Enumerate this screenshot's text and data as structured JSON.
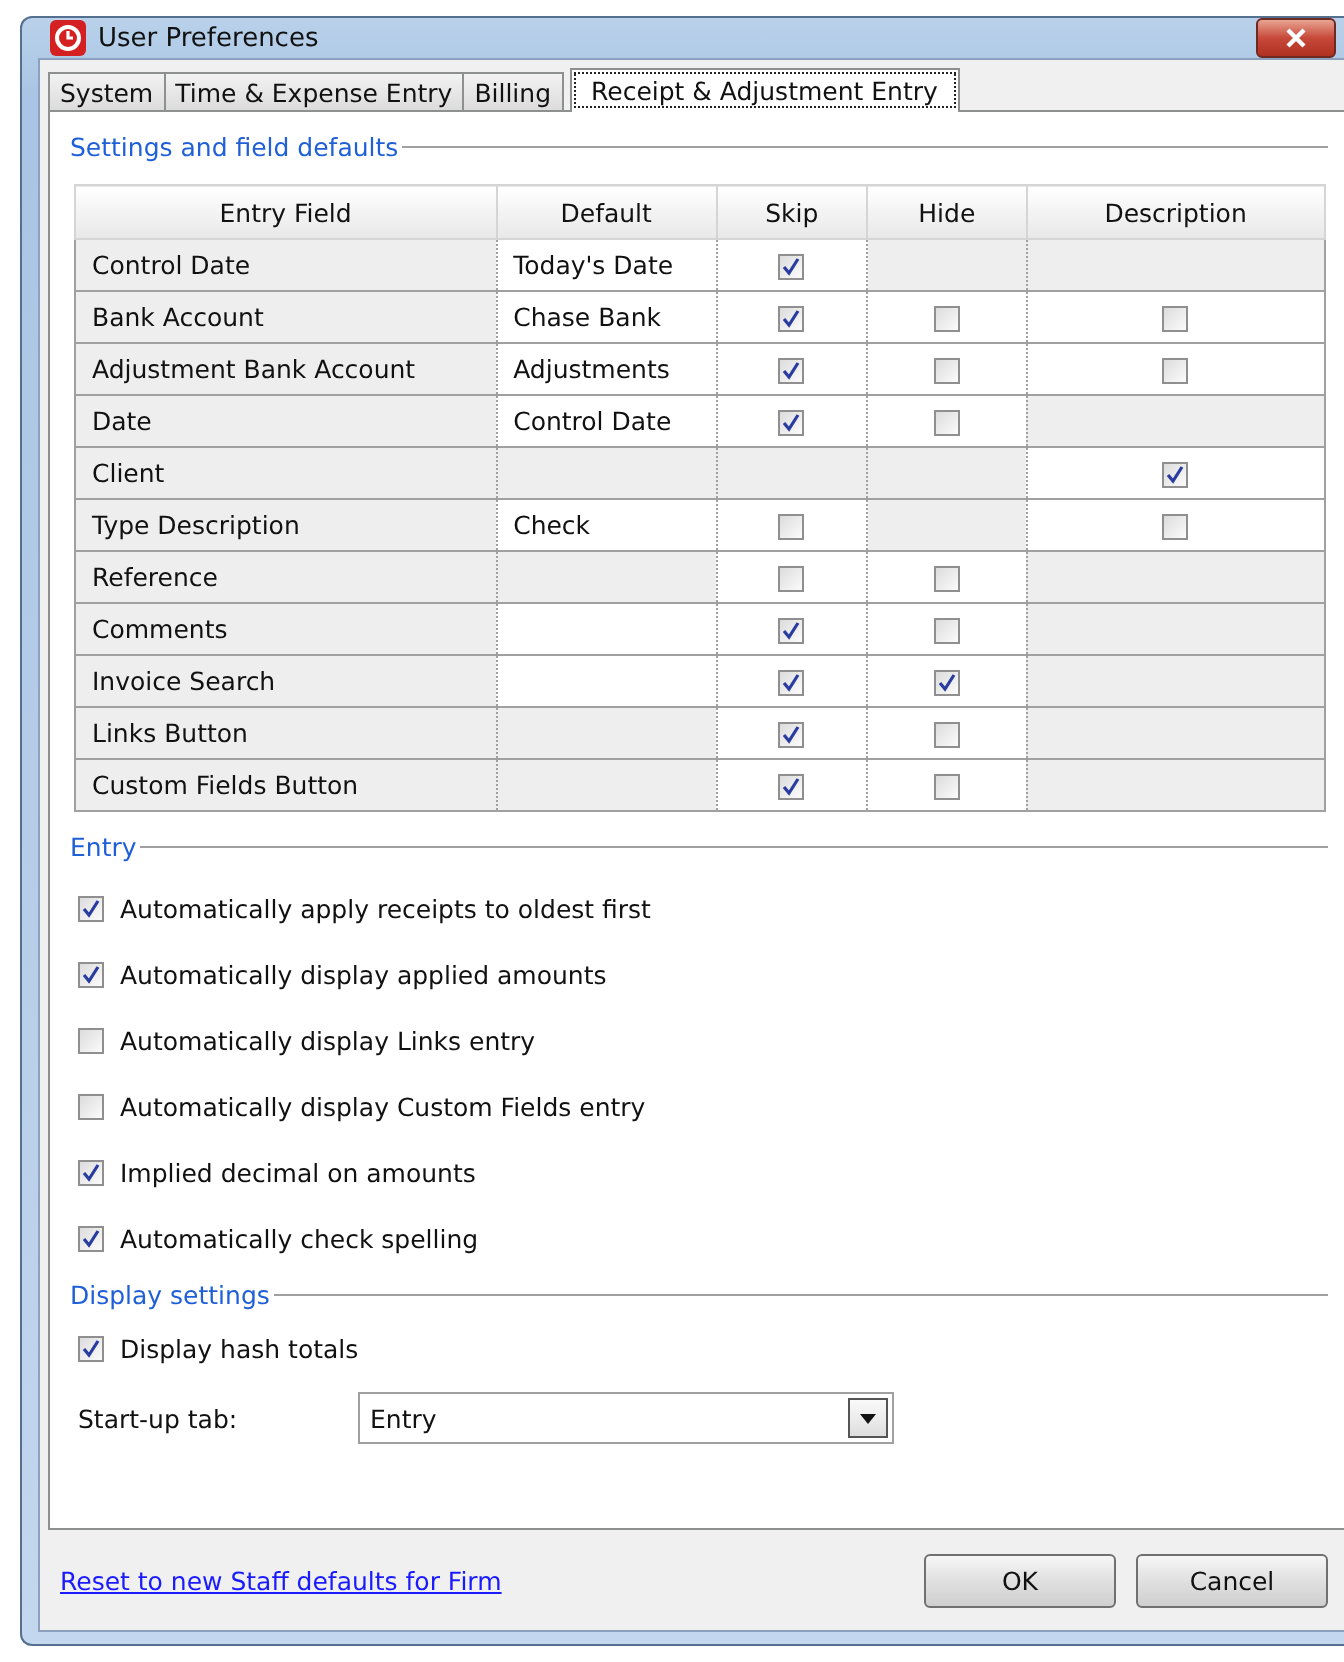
{
  "window": {
    "title": "User Preferences"
  },
  "tabs": [
    {
      "label": "System",
      "selected": false
    },
    {
      "label": "Time & Expense Entry",
      "selected": false
    },
    {
      "label": "Billing",
      "selected": false
    },
    {
      "label": "Receipt & Adjustment Entry",
      "selected": true
    }
  ],
  "settings_section": {
    "title": "Settings and field defaults",
    "columns": [
      "Entry Field",
      "Default",
      "Skip",
      "Hide",
      "Description"
    ],
    "rows": [
      {
        "field": "Control Date",
        "default": {
          "kind": "text",
          "value": "Today's Date"
        },
        "skip": {
          "kind": "checkbox",
          "checked": true
        },
        "hide": {
          "kind": "blank"
        },
        "description": {
          "kind": "blank"
        }
      },
      {
        "field": "Bank Account",
        "default": {
          "kind": "text",
          "value": "Chase Bank"
        },
        "skip": {
          "kind": "checkbox",
          "checked": true
        },
        "hide": {
          "kind": "checkbox",
          "checked": false
        },
        "description": {
          "kind": "checkbox",
          "checked": false
        }
      },
      {
        "field": "Adjustment Bank Account",
        "default": {
          "kind": "text",
          "value": "Adjustments"
        },
        "skip": {
          "kind": "checkbox",
          "checked": true
        },
        "hide": {
          "kind": "checkbox",
          "checked": false
        },
        "description": {
          "kind": "checkbox",
          "checked": false
        }
      },
      {
        "field": "Date",
        "default": {
          "kind": "text",
          "value": "Control Date"
        },
        "skip": {
          "kind": "checkbox",
          "checked": true
        },
        "hide": {
          "kind": "checkbox",
          "checked": false
        },
        "description": {
          "kind": "blank"
        }
      },
      {
        "field": "Client",
        "default": {
          "kind": "blank"
        },
        "skip": {
          "kind": "blank"
        },
        "hide": {
          "kind": "blank"
        },
        "description": {
          "kind": "checkbox",
          "checked": true
        }
      },
      {
        "field": "Type Description",
        "default": {
          "kind": "text",
          "value": "Check"
        },
        "skip": {
          "kind": "checkbox",
          "checked": false
        },
        "hide": {
          "kind": "blank"
        },
        "description": {
          "kind": "checkbox",
          "checked": false
        }
      },
      {
        "field": "Reference",
        "default": {
          "kind": "blank"
        },
        "skip": {
          "kind": "checkbox",
          "checked": false
        },
        "hide": {
          "kind": "checkbox",
          "checked": false
        },
        "description": {
          "kind": "blank"
        }
      },
      {
        "field": "Comments",
        "default": {
          "kind": "empty"
        },
        "skip": {
          "kind": "checkbox",
          "checked": true
        },
        "hide": {
          "kind": "checkbox",
          "checked": false
        },
        "description": {
          "kind": "blank"
        }
      },
      {
        "field": "Invoice Search",
        "default": {
          "kind": "empty"
        },
        "skip": {
          "kind": "checkbox",
          "checked": true
        },
        "hide": {
          "kind": "checkbox",
          "checked": true
        },
        "description": {
          "kind": "blank"
        }
      },
      {
        "field": "Links Button",
        "default": {
          "kind": "blank"
        },
        "skip": {
          "kind": "checkbox",
          "checked": true
        },
        "hide": {
          "kind": "checkbox",
          "checked": false
        },
        "description": {
          "kind": "blank"
        }
      },
      {
        "field": "Custom Fields Button",
        "default": {
          "kind": "blank"
        },
        "skip": {
          "kind": "checkbox",
          "checked": true
        },
        "hide": {
          "kind": "checkbox",
          "checked": false
        },
        "description": {
          "kind": "blank"
        }
      }
    ]
  },
  "entry_section": {
    "title": "Entry",
    "options": [
      {
        "label": "Automatically apply receipts to oldest first",
        "checked": true
      },
      {
        "label": "Automatically display applied amounts",
        "checked": true
      },
      {
        "label": "Automatically display Links entry",
        "checked": false
      },
      {
        "label": "Automatically display Custom Fields entry",
        "checked": false
      },
      {
        "label": "Implied decimal on amounts",
        "checked": true
      },
      {
        "label": "Automatically check spelling",
        "checked": true
      }
    ]
  },
  "display_section": {
    "title": "Display settings",
    "options": [
      {
        "label": "Display hash totals",
        "checked": true
      }
    ],
    "startup_tab": {
      "label": "Start-up tab:",
      "value": "Entry"
    }
  },
  "footer": {
    "link": "Reset to new Staff defaults for Firm",
    "buttons": [
      "OK",
      "Cancel"
    ]
  }
}
